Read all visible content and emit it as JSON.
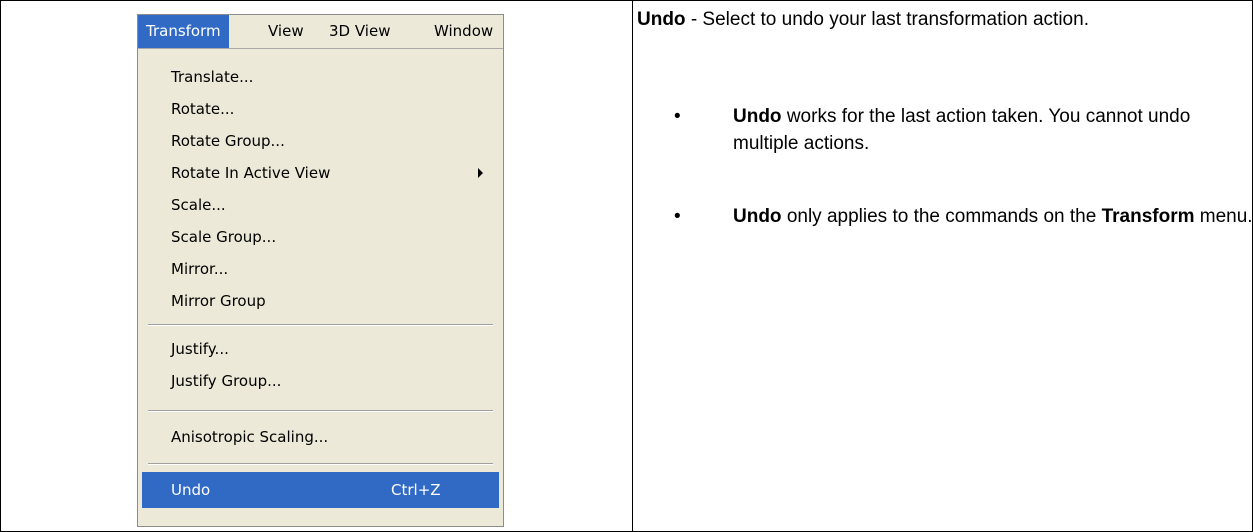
{
  "menubar": {
    "items": [
      "Transform",
      "View",
      "3D View",
      "Window"
    ]
  },
  "menu": {
    "items": [
      {
        "label": "Translate..."
      },
      {
        "label": "Rotate..."
      },
      {
        "label": "Rotate Group..."
      },
      {
        "label": "Rotate In Active View"
      },
      {
        "label": "Scale..."
      },
      {
        "label": "Scale Group..."
      },
      {
        "label": "Mirror..."
      },
      {
        "label": "Mirror Group"
      },
      {
        "label": "Justify..."
      },
      {
        "label": "Justify Group..."
      },
      {
        "label": "Anisotropic Scaling..."
      },
      {
        "label": "Undo",
        "shortcut": "Ctrl+Z"
      }
    ]
  },
  "help": {
    "term": "Undo",
    "description": " - Select to undo your last transformation action.",
    "bullet1": {
      "term": "Undo",
      "text": " works for the last action taken. You cannot undo multiple actions."
    },
    "bullet2": {
      "term": "Undo",
      "text_a": " only applies to the commands on the ",
      "term2": "Transform",
      "text_b": " menu."
    }
  },
  "colors": {
    "highlight": "#316ac5",
    "menu_bg": "#ece9d8"
  }
}
